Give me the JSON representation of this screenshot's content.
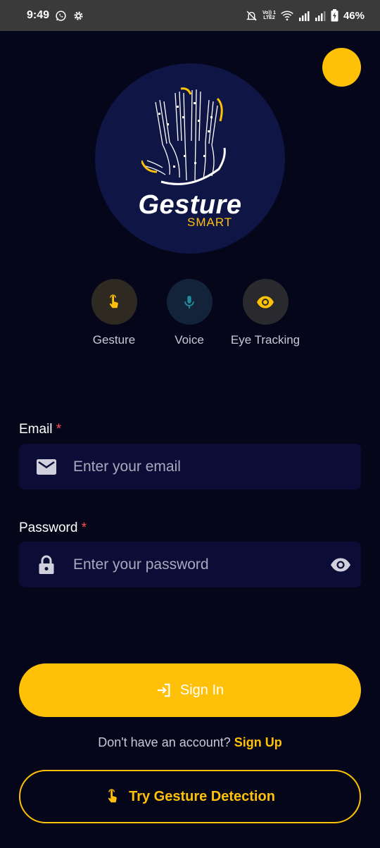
{
  "status_bar": {
    "time": "9:49",
    "network_top": "Vo)) 1",
    "network_bottom": "LTE2",
    "battery": "46%"
  },
  "logo": {
    "word": "Gesture",
    "subword": "SMART"
  },
  "modes": [
    {
      "label": "Gesture",
      "icon": "tap-hand-icon",
      "bg": "#2e2a22",
      "color": "#ffc107"
    },
    {
      "label": "Voice",
      "icon": "microphone-icon",
      "bg": "#12233a",
      "color": "#1f8a99"
    },
    {
      "label": "Eye Tracking",
      "icon": "eye-icon",
      "bg": "#2a2a2e",
      "color": "#ffc107"
    }
  ],
  "form": {
    "email_label": "Email",
    "email_required": "*",
    "email_placeholder": "Enter your email",
    "password_label": "Password",
    "password_required": "*",
    "password_placeholder": "Enter your password"
  },
  "actions": {
    "sign_in": "Sign In",
    "no_account": "Don't have an account?",
    "sign_up": "Sign Up",
    "try_gesture": "Try Gesture Detection"
  },
  "colors": {
    "background": "#05061a",
    "accent": "#ffc107",
    "field_bg": "#0c0d36",
    "logo_circle": "#0f1545"
  }
}
